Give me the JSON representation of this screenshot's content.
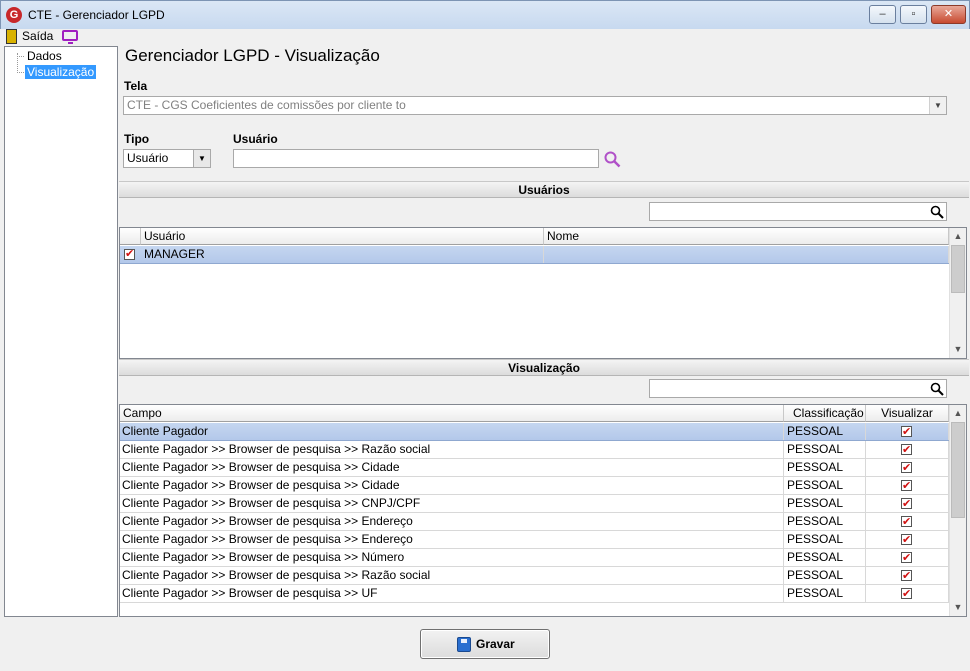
{
  "window": {
    "title": "CTE - Gerenciador LGPD",
    "app_icon": "G",
    "min": "–",
    "max": "▫",
    "close": "✕"
  },
  "menu": {
    "exit_label": "Saída"
  },
  "tree": {
    "items": [
      "Dados",
      "Visualização"
    ],
    "selected": "Visualização"
  },
  "page": {
    "title": "Gerenciador LGPD - Visualização"
  },
  "form": {
    "tela_label": "Tela",
    "tela_value": "CTE - CGS Coeficientes de comissões por cliente to",
    "tipo_label": "Tipo",
    "tipo_value": "Usuário",
    "usuario_label": "Usuário",
    "usuario_value": ""
  },
  "usuarios": {
    "header": "Usuários",
    "search_value": "",
    "columns": [
      "Usuário",
      "Nome"
    ],
    "rows": [
      {
        "usuario": "MANAGER",
        "nome": "",
        "checked": true
      }
    ]
  },
  "visualizacao": {
    "header": "Visualização",
    "search_value": "",
    "columns": [
      "Campo",
      "Classificação",
      "Visualizar"
    ],
    "rows": [
      {
        "campo": "Cliente Pagador",
        "classificacao": "PESSOAL",
        "visualizar": true
      },
      {
        "campo": "Cliente Pagador >> Browser de pesquisa >>  Razão social",
        "classificacao": "PESSOAL",
        "visualizar": true
      },
      {
        "campo": "Cliente Pagador >> Browser de pesquisa >> Cidade",
        "classificacao": "PESSOAL",
        "visualizar": true
      },
      {
        "campo": "Cliente Pagador >> Browser de pesquisa >> Cidade",
        "classificacao": "PESSOAL",
        "visualizar": true
      },
      {
        "campo": "Cliente Pagador >> Browser de pesquisa >> CNPJ/CPF",
        "classificacao": "PESSOAL",
        "visualizar": true
      },
      {
        "campo": "Cliente Pagador >> Browser de pesquisa >> Endereço",
        "classificacao": "PESSOAL",
        "visualizar": true
      },
      {
        "campo": "Cliente Pagador >> Browser de pesquisa >> Endereço",
        "classificacao": "PESSOAL",
        "visualizar": true
      },
      {
        "campo": "Cliente Pagador >> Browser de pesquisa >> Número",
        "classificacao": "PESSOAL",
        "visualizar": true
      },
      {
        "campo": "Cliente Pagador >> Browser de pesquisa >> Razão social",
        "classificacao": "PESSOAL",
        "visualizar": true
      },
      {
        "campo": "Cliente Pagador >> Browser de pesquisa >> UF",
        "classificacao": "PESSOAL",
        "visualizar": true
      }
    ]
  },
  "actions": {
    "gravar_label": "Gravar"
  },
  "colors": {
    "accent": "#3399ff",
    "check": "#d01010",
    "search_icon": "#b050c8"
  }
}
